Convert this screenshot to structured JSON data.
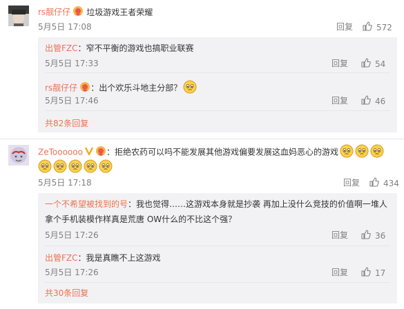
{
  "comments": [
    {
      "user": "rs靓仔仔",
      "text": "垃圾游戏王者荣耀",
      "time": "5月5日 17:08",
      "reply_label": "回复",
      "likes": "572",
      "replies": [
        {
          "user": "出管FZC",
          "text": "：窄不平衡的游戏也搞职业联赛",
          "time": "5月5日 17:33",
          "reply_label": "回复",
          "likes": "54"
        },
        {
          "user": "rs靓仔仔",
          "text": "：出个欢乐斗地主分部？",
          "time": "5月5日 17:46",
          "reply_label": "回复",
          "likes": "46"
        }
      ],
      "more": "共82条回复"
    },
    {
      "user": "ZeToooooo",
      "text_line1": "：拒绝农药可以吗不能发展其他游戏偏要发展这血妈恶心的游戏",
      "time": "5月5日 17:18",
      "reply_label": "回复",
      "likes": "434",
      "replies": [
        {
          "user": "一个不希望被找到的号",
          "text_line1": "：我也觉得……这游戏本身就是抄袭 再加上没什么竞技的价值啊一堆人",
          "text_line2": "拿个手机装模作样真是荒唐 OW什么的不比这个强？",
          "time": "5月5日 17:26",
          "reply_label": "回复",
          "likes": "36"
        },
        {
          "user": "出管FZC",
          "text": "：我是真瞧不上这游戏",
          "time": "5月5日 17:26",
          "reply_label": "回复",
          "likes": "17"
        }
      ],
      "more": "共30条回复"
    }
  ],
  "colors": {
    "name": "#eb7350",
    "meta": "#808080",
    "text": "#333333",
    "subbox": "#f2f2f5"
  },
  "icons": {
    "like": "thumbs-up-icon",
    "vip": "vip-badge-icon",
    "emoji": "smirk-emoji-icon"
  }
}
